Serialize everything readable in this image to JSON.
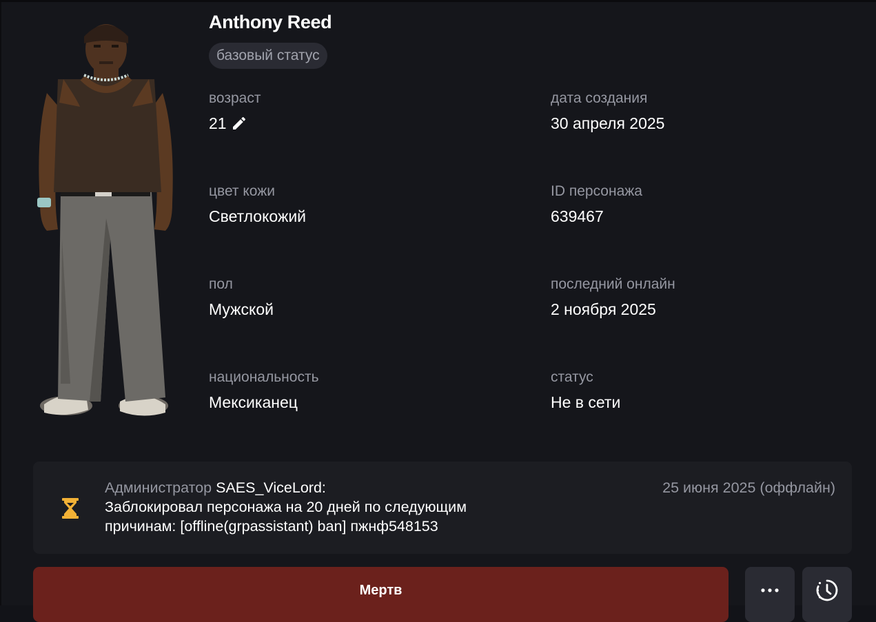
{
  "profile": {
    "name": "Anthony Reed",
    "status_badge": "базовый статус"
  },
  "fields": {
    "age": {
      "label": "возраст",
      "value": "21"
    },
    "created": {
      "label": "дата создания",
      "value": "30 апреля 2025"
    },
    "skin": {
      "label": "цвет кожи",
      "value": "Светлокожий"
    },
    "char_id": {
      "label": "ID персонажа",
      "value": "639467"
    },
    "gender": {
      "label": "пол",
      "value": "Мужской"
    },
    "last_online": {
      "label": "последний онлайн",
      "value": "2 ноября 2025"
    },
    "nationality": {
      "label": "национальность",
      "value": "Мексиканец"
    },
    "status": {
      "label": "статус",
      "value": "Не в сети"
    }
  },
  "notice": {
    "role": "Администратор",
    "admin": "SAES_ViceLord:",
    "line1": "Заблокировал персонажа на 20 дней по следующим",
    "line2": "причинам: [offline(grpassistant) ban] пжнф548153",
    "date": "25 июня 2025 (оффлайн)"
  },
  "actions": {
    "status_button": "Мертв"
  },
  "icons": {
    "edit": "pencil-icon",
    "notice": "hourglass-icon",
    "more": "more-dots-icon",
    "history": "history-clock-icon"
  },
  "colors": {
    "background": "#15161b",
    "accent_hourglass": "#f2b136",
    "status_button": "#6b211c",
    "muted_text": "#9597a1"
  }
}
